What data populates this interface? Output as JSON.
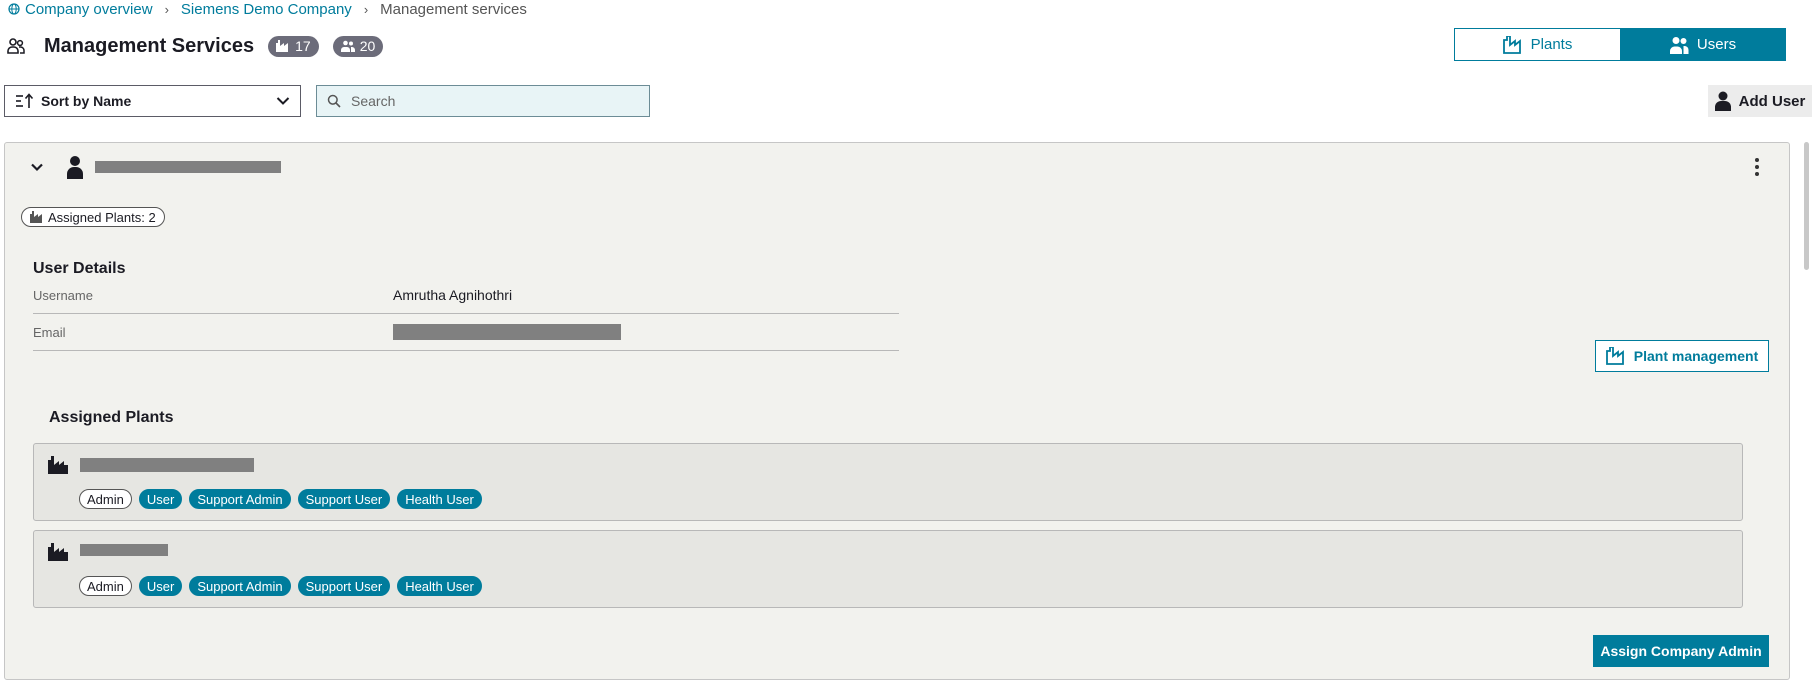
{
  "breadcrumb": {
    "items": [
      {
        "label": "Company overview",
        "icon": "globe-icon"
      },
      {
        "label": "Siemens Demo Company"
      },
      {
        "label": "Management services"
      }
    ]
  },
  "header": {
    "title": "Management Services",
    "plants_count": "17",
    "users_count": "20"
  },
  "view_toggle": {
    "plants_label": "Plants",
    "users_label": "Users",
    "active": "Users"
  },
  "toolbar": {
    "sort_label": "Sort by Name",
    "search_placeholder": "Search",
    "add_user_label": "Add User"
  },
  "user": {
    "assigned_plants_label": "Assigned Plants: 2",
    "details_title": "User Details",
    "username_label": "Username",
    "username_value": "Amrutha Agnihothri",
    "email_label": "Email",
    "plant_management_label": "Plant management",
    "assigned_plants_title": "Assigned Plants",
    "plants": [
      {
        "roles": [
          "Admin",
          "User",
          "Support Admin",
          "Support User",
          "Health User"
        ]
      },
      {
        "roles": [
          "Admin",
          "User",
          "Support Admin",
          "Support User",
          "Health User"
        ]
      }
    ],
    "assign_admin_label": "Assign Company Admin"
  },
  "colors": {
    "accent": "#007c9c",
    "card_bg": "#f2f2ee",
    "plant_bg": "#e6e6e2",
    "badge_bg": "#6c6c7a"
  }
}
